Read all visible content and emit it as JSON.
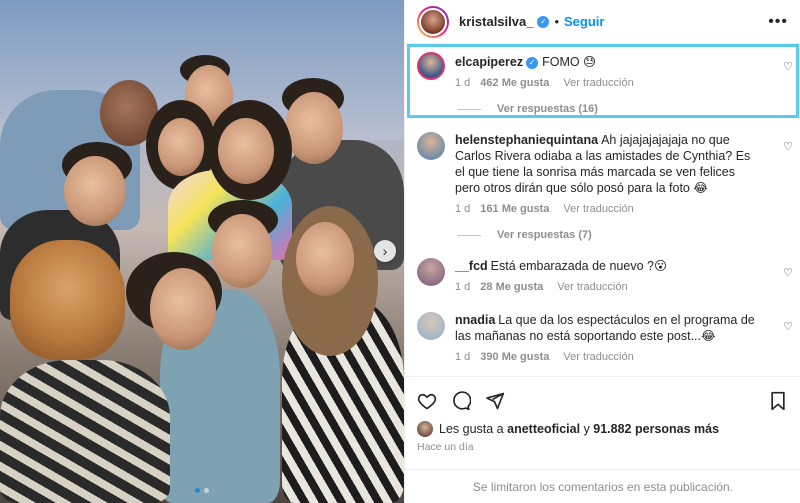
{
  "post": {
    "author": "kristalsilva_",
    "follow_label": "Seguir",
    "more_label": "•••",
    "separator": "•"
  },
  "comments": [
    {
      "user": "elcapiperez",
      "verified": true,
      "text": "FOMO 😓",
      "time": "1 d",
      "likes": "462 Me gusta",
      "translate": "Ver traducción",
      "replies": "Ver respuestas (16)",
      "avatar_color": "#3b5a8c"
    },
    {
      "user": "helenstephaniequintana",
      "verified": false,
      "text": "Ah jajajajajajaja no que Carlos Rivera odiaba a las amistades de Cynthia? Es el que tiene la sonrisa más marcada se ven felices pero otros dirán que sólo posó para la foto 😂",
      "time": "1 d",
      "likes": "161 Me gusta",
      "translate": "Ver traducción",
      "replies": "Ver respuestas (7)",
      "avatar_color": "#6d8ba5"
    },
    {
      "user": "__fcd",
      "verified": false,
      "text": "Está embarazada de nuevo ?😮",
      "time": "1 d",
      "likes": "28 Me gusta",
      "translate": "Ver traducción",
      "avatar_color": "#8a6b86"
    },
    {
      "user": "nnadia",
      "verified": false,
      "text": "La que da los espectáculos en el programa de las mañanas no está soportando este post...😂",
      "time": "1 d",
      "likes": "390 Me gusta",
      "translate": "Ver traducción",
      "avatar_color": "#9fb6c9"
    }
  ],
  "likes_summary": {
    "prefix": "Les gusta a",
    "user": "anetteoficial",
    "conjunction": "y",
    "others": "91.882 personas más"
  },
  "posted_ago": "Hace un día",
  "comments_limited": "Se limitaron los comentarios en esta publicación.",
  "colors": {
    "accent": "#0095f6",
    "verified": "#3897f0",
    "highlight_border": "#5cc8ec",
    "active_dot": "#2f7bd9"
  },
  "icons": [
    "chevron-right-icon",
    "heart-icon",
    "comment-icon",
    "share-icon",
    "bookmark-icon",
    "more-icon",
    "verified-icon"
  ]
}
